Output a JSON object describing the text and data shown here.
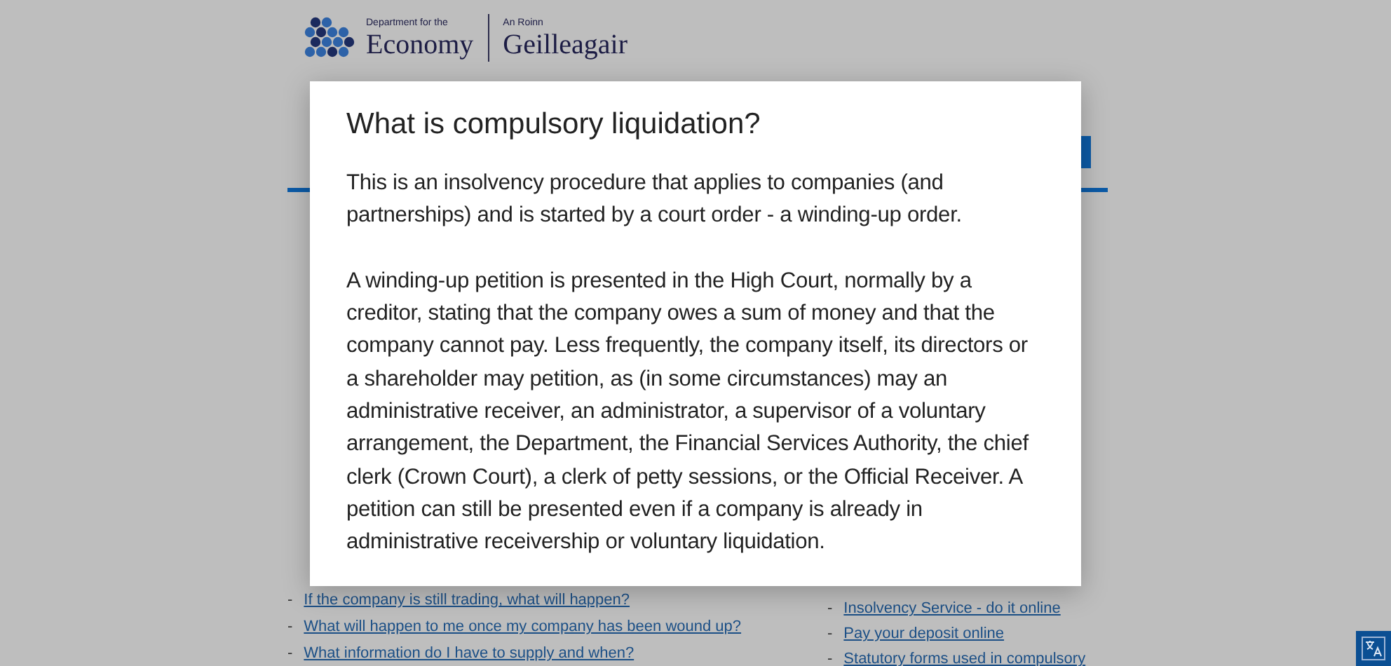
{
  "header": {
    "logo_left_small": "Department for the",
    "logo_left_big": "Economy",
    "logo_right_small": "An Roinn",
    "logo_right_big": "Geilleagair"
  },
  "left_links": [
    {
      "bullet": "-",
      "text": "If the company is still trading, what will happen?"
    },
    {
      "bullet": "-",
      "text": "What will happen to me once my company has been wound up?"
    },
    {
      "bullet": "-",
      "text": "What information do I have to supply and when?"
    }
  ],
  "right_links": [
    {
      "bullet": "-",
      "text": "Insolvency Service - do it online"
    },
    {
      "bullet": "-",
      "text": "Pay your deposit online"
    },
    {
      "bullet": "-",
      "text": "Statutory forms used in compulsory"
    }
  ],
  "dialog": {
    "title": "What is compulsory liquidation?",
    "paragraphs": [
      "This is an insolvency procedure that applies to companies (and partnerships) and is started by a court order - a winding-up order.",
      "A winding-up petition is presented in the High Court, normally by a creditor, stating that the company owes a sum of money and that the company cannot pay. Less frequently, the company itself, its directors or a shareholder may petition, as (in some circumstances) may an administrative receiver, an administrator, a supervisor of a voluntary arrangement, the Department, the Financial Services Authority, the chief clerk (Crown Court), a clerk of petty sessions, or the Official Receiver. A petition can still be presented even if a company is already in administrative receivership or voluntary liquidation."
    ]
  }
}
